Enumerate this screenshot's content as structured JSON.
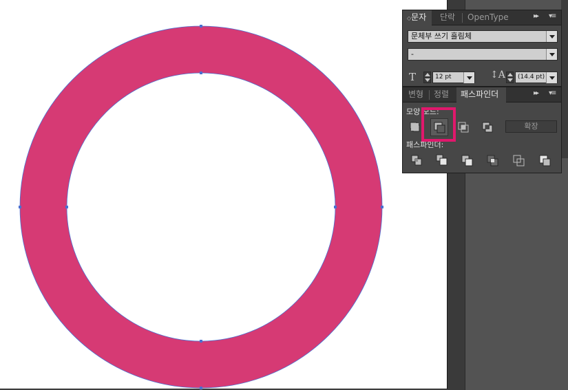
{
  "character_panel": {
    "tabs": [
      {
        "label": "문자",
        "active": true
      },
      {
        "label": "단락",
        "active": false
      },
      {
        "label": "OpenType",
        "active": false
      }
    ],
    "font_family": "문체부 쓰기 흘림체",
    "font_style": "-",
    "font_size": "12 pt",
    "leading": "(14.4 pt)",
    "collapse_glyph": "▸▸",
    "menu_glyph": "▾≡",
    "tab_marker": "◇"
  },
  "pathfinder_panel": {
    "tabs": [
      {
        "label": "변형",
        "active": false
      },
      {
        "label": "정렬",
        "active": false
      },
      {
        "label": "패스파인더",
        "active": true
      }
    ],
    "shape_modes_label": "모양 모드:",
    "shape_mode_buttons": [
      "unite",
      "minus-front",
      "intersect",
      "exclude"
    ],
    "expand_label": "확장",
    "pathfinders_label": "패스파인더:",
    "pathfinder_buttons": [
      "divide",
      "trim",
      "merge",
      "crop",
      "outline",
      "minus-back"
    ],
    "collapse_glyph": "▸▸",
    "menu_glyph": "▾≡"
  },
  "colors": {
    "ring_fill": "#d63a74",
    "path_outline": "#4a6fd0",
    "highlight": "#e0186c"
  }
}
